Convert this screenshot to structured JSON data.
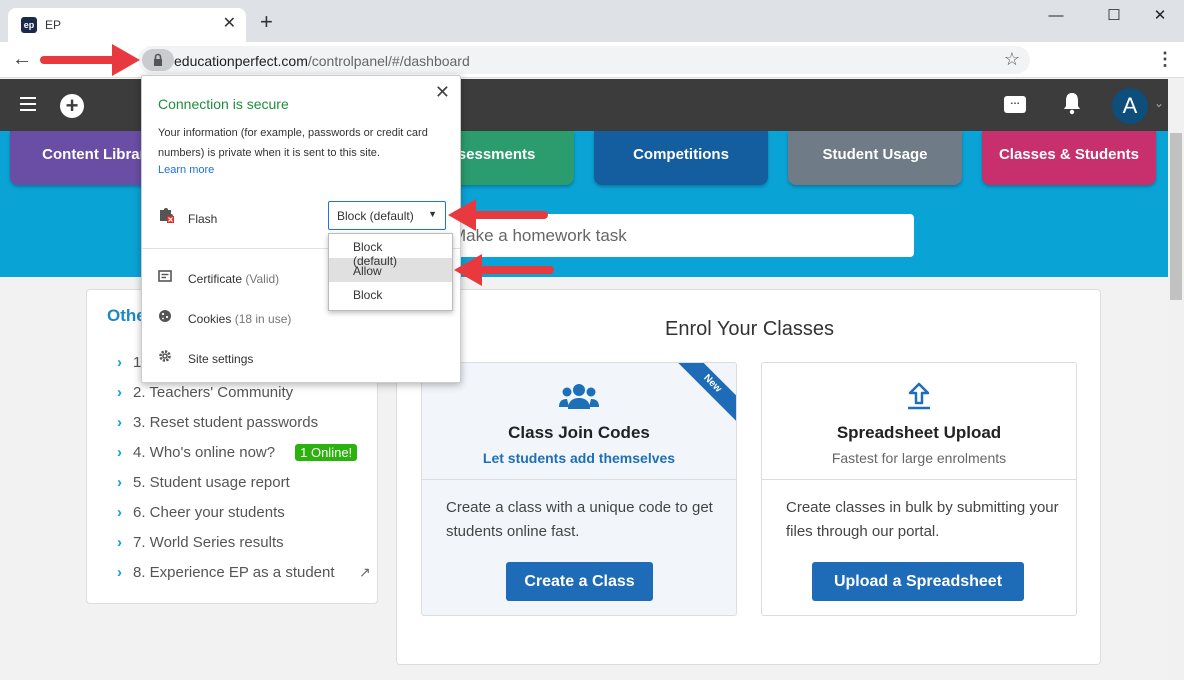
{
  "browser": {
    "tab_title": "EP",
    "favicon_text": "ep",
    "url_host": "educationperfect.com",
    "url_path": "/controlpanel/#/dashboard"
  },
  "app": {
    "avatar_letter": "A"
  },
  "nav_tiles": [
    {
      "label": "Content Library",
      "color": "#6a4ea6"
    },
    {
      "label": "Assessments",
      "color": "#2a9c6d"
    },
    {
      "label": "Competitions",
      "color": "#145ea0"
    },
    {
      "label": "Student Usage",
      "color": "#6f7b86"
    },
    {
      "label": "Classes & Students",
      "color": "#c8306d"
    }
  ],
  "search": {
    "text": "Make a homework task"
  },
  "others": {
    "title": "Other",
    "items": [
      {
        "label": "1."
      },
      {
        "label": "2. Teachers' Community"
      },
      {
        "label": "3. Reset student passwords"
      },
      {
        "label": "4. Who's online now?",
        "badge": "1 Online!"
      },
      {
        "label": "5. Student usage report"
      },
      {
        "label": "6. Cheer your students"
      },
      {
        "label": "7. World Series results"
      },
      {
        "label": "8. Experience EP as a student"
      }
    ]
  },
  "enrol": {
    "title": "Enrol Your Classes",
    "options": [
      {
        "heading": "Class Join Codes",
        "sub": "Let students add themselves",
        "description": "Create a class with a unique code to get students online fast.",
        "button": "Create a Class",
        "ribbon": "New"
      },
      {
        "heading": "Spreadsheet Upload",
        "sub": "Fastest for large enrolments",
        "description": "Create classes in bulk by submitting your files through our portal.",
        "button": "Upload a Spreadsheet"
      }
    ]
  },
  "popup": {
    "title": "Connection is secure",
    "description": "Your information (for example, passwords or credit card numbers) is private when it is sent to this site.",
    "learn_more": "Learn more",
    "flash_label": "Flash",
    "flash_value": "Block (default)",
    "certificate_label": "Certificate",
    "certificate_status": "(Valid)",
    "cookies_label": "Cookies",
    "cookies_status": "(18 in use)",
    "site_settings_label": "Site settings",
    "dropdown_options": [
      "Block (default)",
      "Allow",
      "Block"
    ],
    "highlighted_option": "Allow"
  },
  "colors": {
    "banner": "#0aa3d6",
    "header": "#3c3c3c",
    "button": "#1e6bb8",
    "annotation_arrow": "#e8393f",
    "secure_green": "#1e8e3e"
  }
}
